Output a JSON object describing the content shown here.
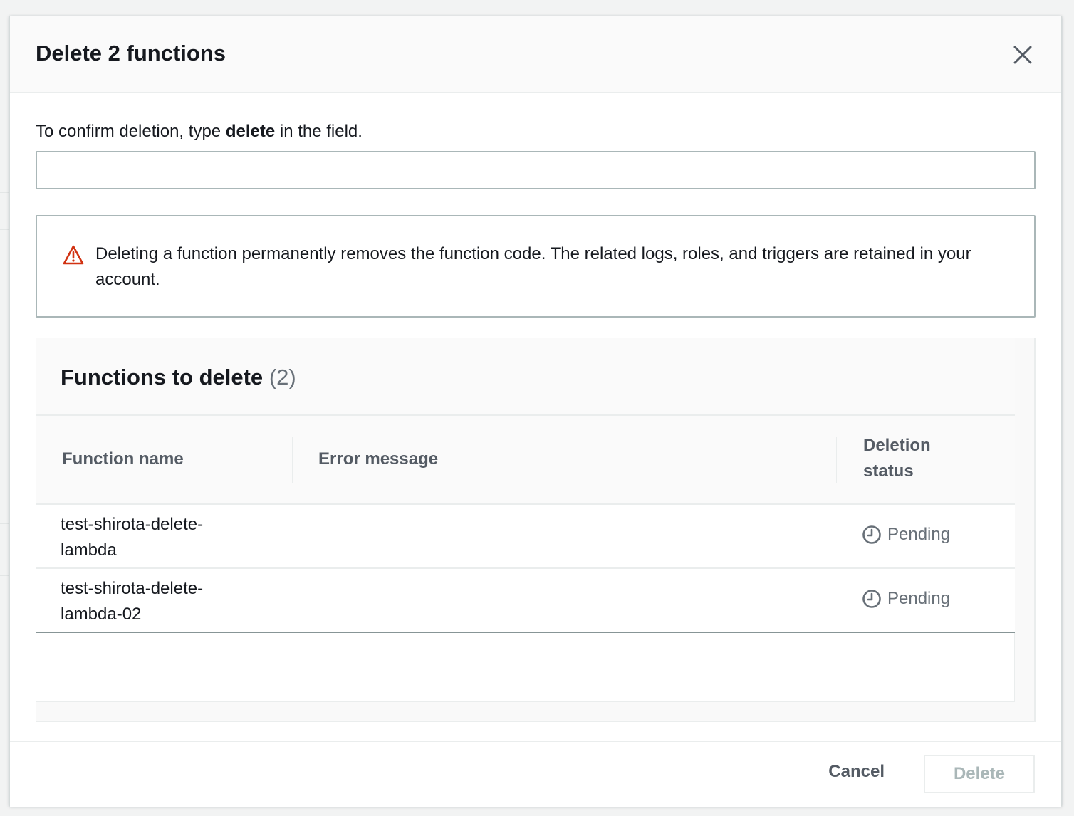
{
  "modal": {
    "title": "Delete 2 functions",
    "confirm_prefix": "To confirm deletion, type ",
    "confirm_keyword": "delete",
    "confirm_suffix": " in the field.",
    "input_value": "",
    "alert_text": "Deleting a function permanently removes the function code. The related logs, roles, and triggers are retained in your account.",
    "icons": {
      "close": "close-icon",
      "warning": "warning-icon",
      "status": "clock-icon"
    },
    "colors": {
      "warning": "#d13212",
      "disabled": "#aab7b8"
    }
  },
  "functions": {
    "title": "Functions to delete",
    "count": "(2)",
    "columns": [
      "Function name",
      "Error message",
      "Deletion status"
    ],
    "rows": [
      {
        "name": "test-shirota-delete-lambda",
        "error": "",
        "status": "Pending"
      },
      {
        "name": "test-shirota-delete-lambda-02",
        "error": "",
        "status": "Pending"
      }
    ]
  },
  "footer": {
    "cancel_label": "Cancel",
    "delete_label": "Delete"
  }
}
